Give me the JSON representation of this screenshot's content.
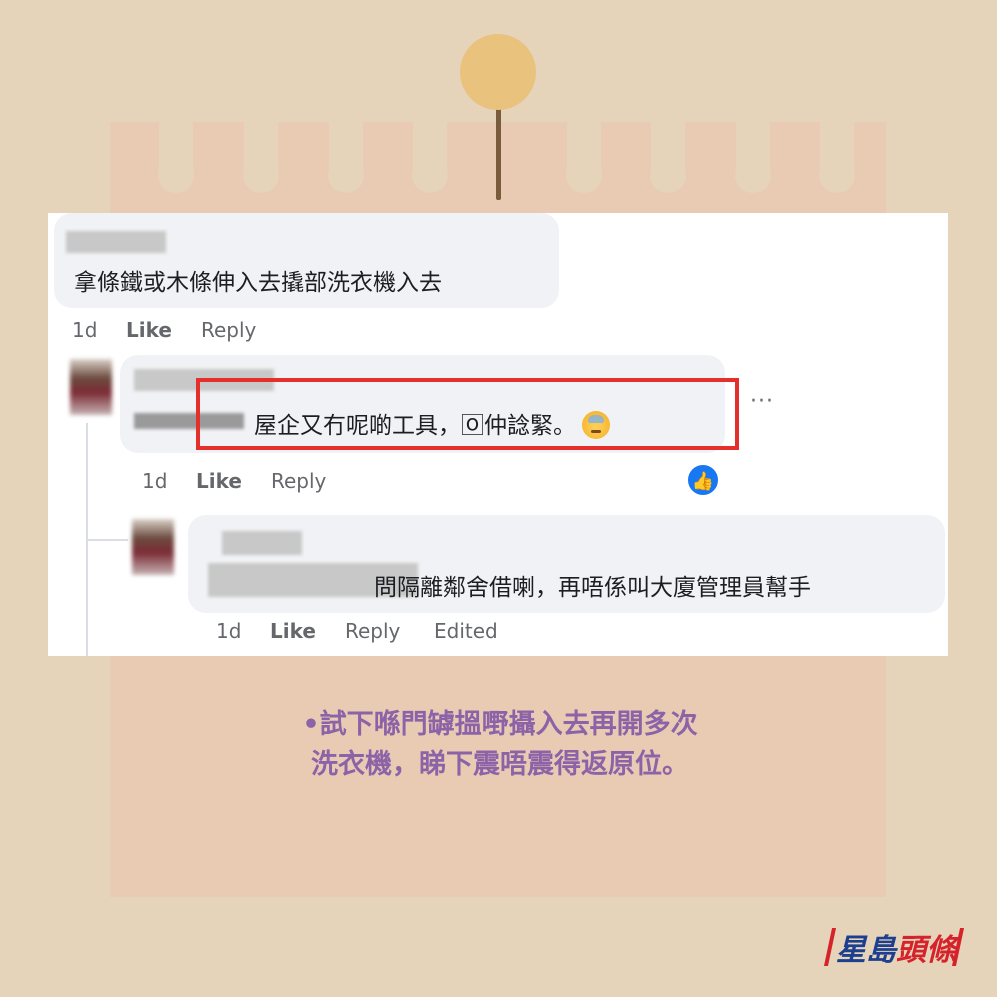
{
  "comments": [
    {
      "text": "拿條鐵或木條伸入去撬部洗衣機入去",
      "time": "1d",
      "like_label": "Like",
      "reply_label": "Reply"
    },
    {
      "text": "屋企又冇呢啲工具，🄾仲諗緊。",
      "time": "1d",
      "like_label": "Like",
      "reply_label": "Reply",
      "more_label": "···"
    },
    {
      "text": "問隔離鄰舍借喇，再唔係叫大廈管理員幫手",
      "time": "1d",
      "like_label": "Like",
      "reply_label": "Reply",
      "edited_label": "Edited"
    }
  ],
  "icons": {
    "emoji": "sweat-smile-emoji-icon",
    "like_reaction": "thumbs-up-icon",
    "more": "more-dots-icon"
  },
  "caption": {
    "line1": "•試下喺門罅搵嘢攝入去再開多次",
    "line2": "洗衣機，睇下震唔震得返原位。"
  },
  "logo": {
    "part1": "星島",
    "part2": "頭條"
  },
  "colors": {
    "background": "#e5d4b9",
    "paper": "#e9cbb4",
    "highlight": "#e4302a",
    "caption": "#8d63a8",
    "like_blue": "#1877f2"
  }
}
